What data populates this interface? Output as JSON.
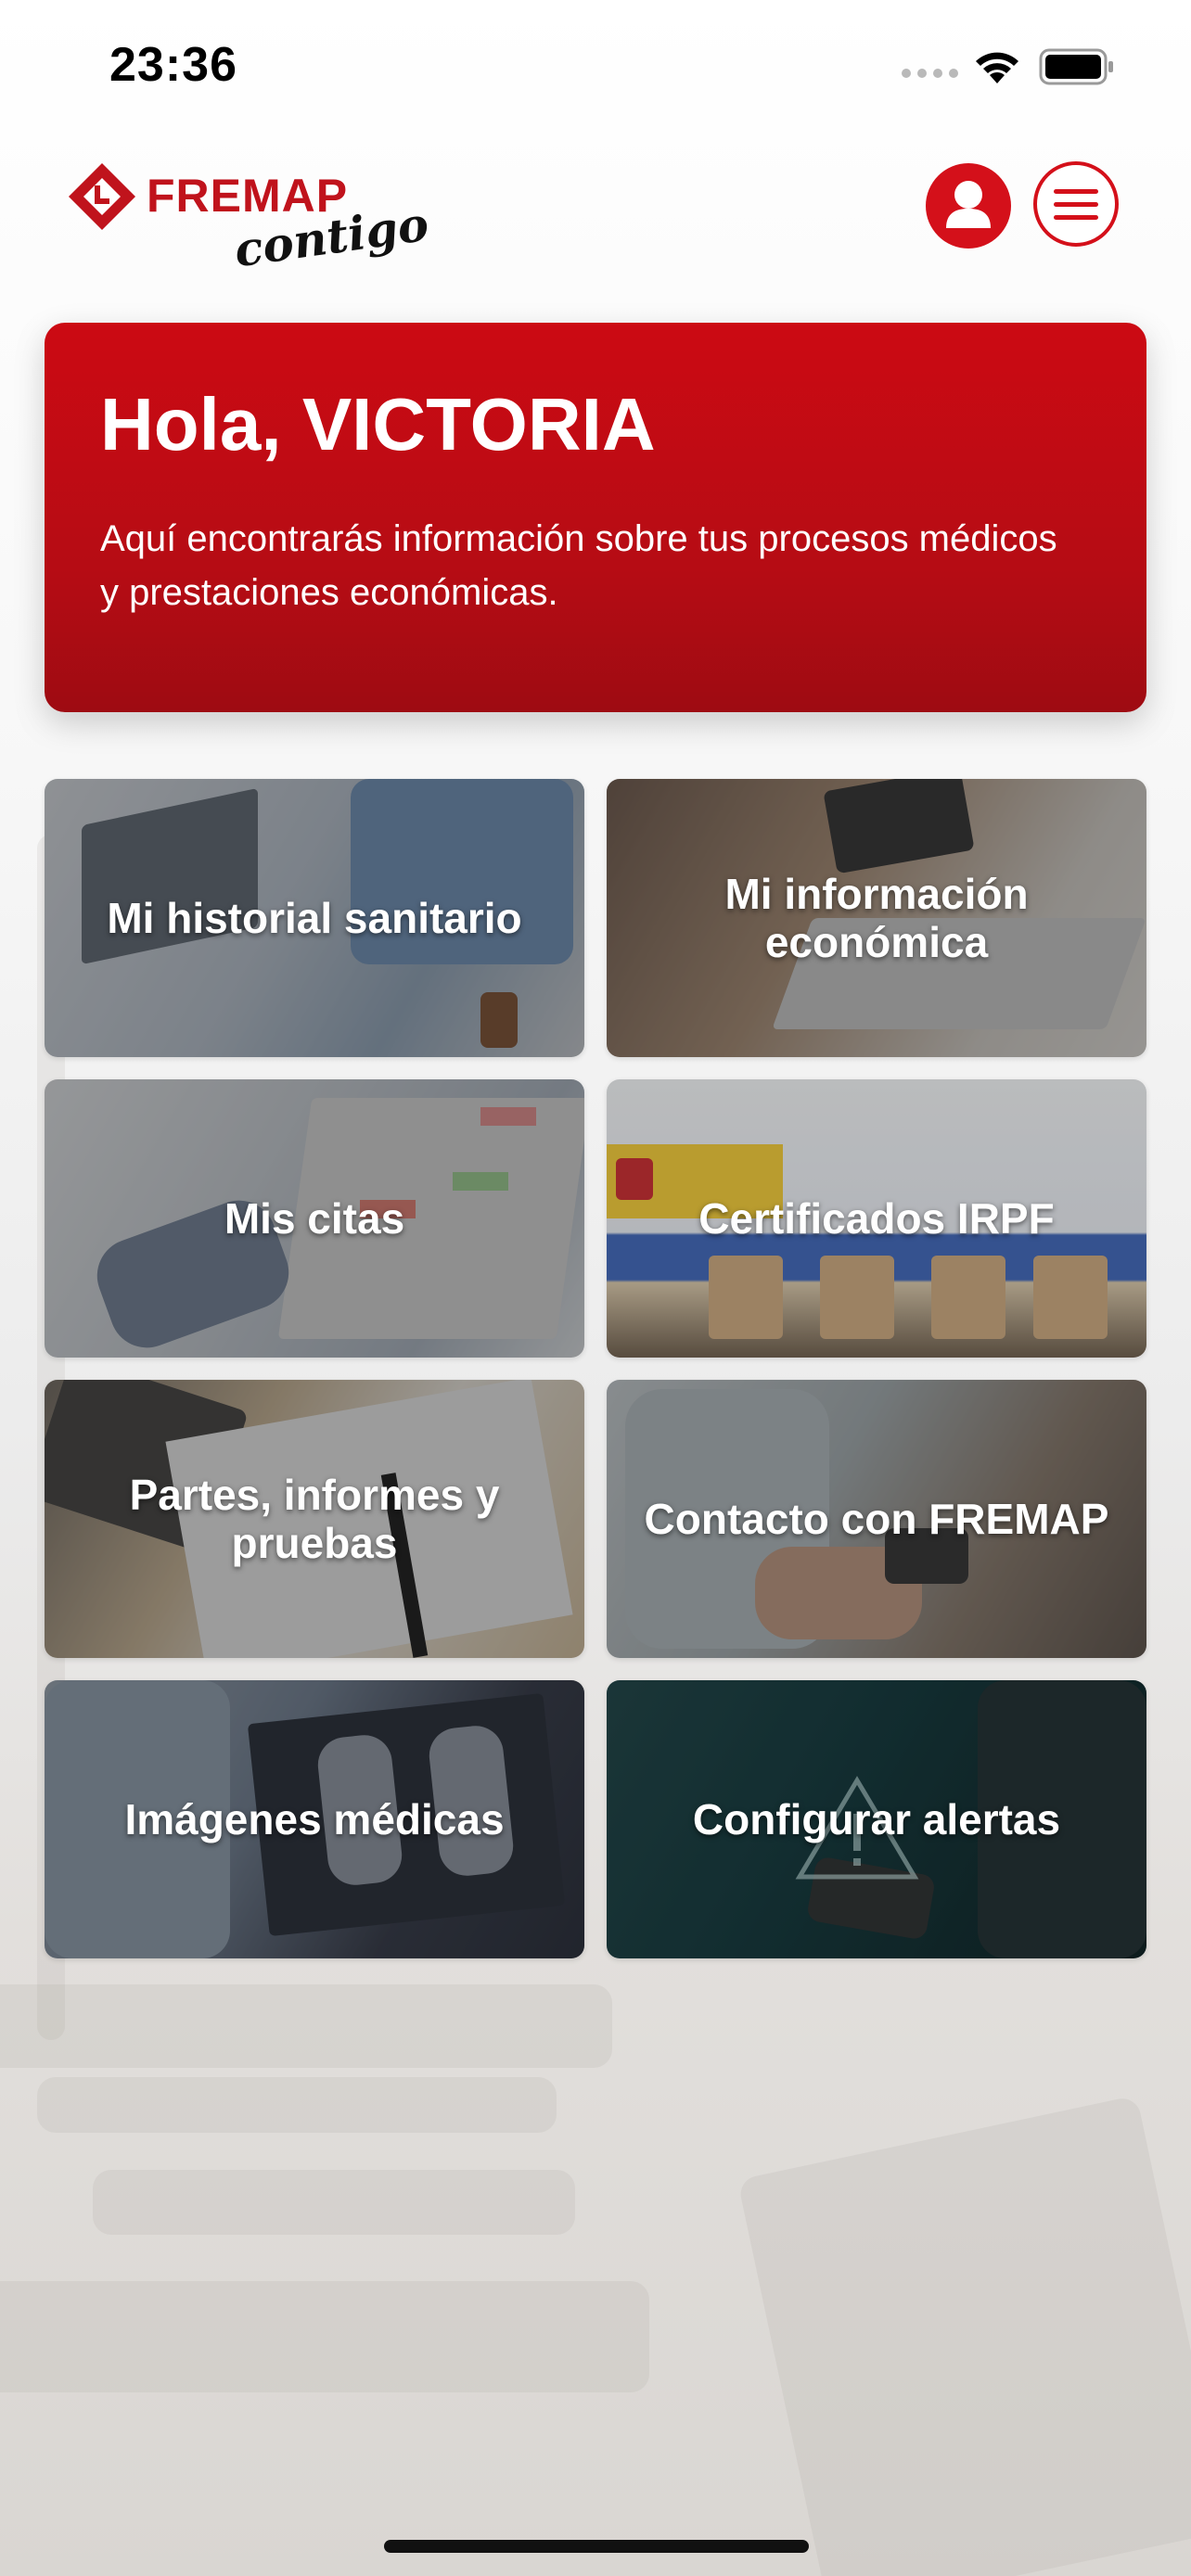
{
  "status_bar": {
    "time": "23:36"
  },
  "header": {
    "logo_word": "FREMAP",
    "logo_tagline": "contigo"
  },
  "welcome": {
    "title": "Hola, VICTORIA",
    "text": "Aquí encontrarás información sobre tus procesos médicos y prestaciones económicas."
  },
  "tiles": [
    {
      "label": "Mi historial sanitario"
    },
    {
      "label": "Mi información económica"
    },
    {
      "label": "Mis citas"
    },
    {
      "label": "Certificados IRPF"
    },
    {
      "label": "Partes, informes y pruebas"
    },
    {
      "label": "Contacto con FREMAP"
    },
    {
      "label": "Imágenes médicas"
    },
    {
      "label": "Configurar alertas"
    }
  ],
  "icons": {
    "user": "user-icon",
    "menu": "hamburger-menu-icon",
    "wifi": "wifi-icon",
    "battery": "battery-icon",
    "signal": "cellular-signal-icon"
  },
  "colors": {
    "brand_red": "#d4101a",
    "card_red": "#b50c14"
  }
}
